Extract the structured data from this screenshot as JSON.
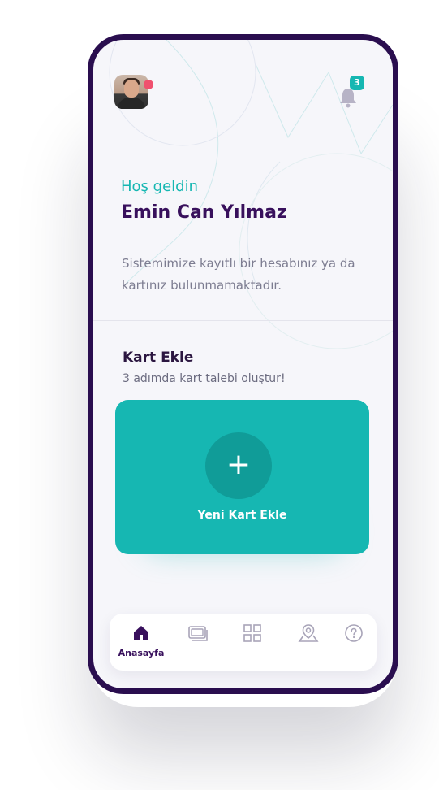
{
  "header": {
    "avatar_alt": "user-avatar",
    "notification_count": "3",
    "colors": {
      "badge": "#16b7b2",
      "status_dot": "#f0506e"
    }
  },
  "welcome": {
    "greeting": "Hoş geldin",
    "name": "Emin Can Yılmaz",
    "info": "Sistemimize kayıtlı bir hesabınız ya da kartınız bulunmamaktadır."
  },
  "add_card_section": {
    "title": "Kart Ekle",
    "subtitle": "3 adımda kart talebi oluştur!",
    "button_label": "Yeni Kart Ekle",
    "plus_symbol": "+"
  },
  "tabbar": {
    "items": [
      {
        "icon": "home-icon",
        "label": "Anasayfa",
        "active": true
      },
      {
        "icon": "wallet-icon",
        "label": "",
        "active": false
      },
      {
        "icon": "grid-icon",
        "label": "",
        "active": false
      },
      {
        "icon": "map-pin-icon",
        "label": "",
        "active": false
      },
      {
        "icon": "help-icon",
        "label": "",
        "active": false
      }
    ]
  },
  "colors": {
    "primary": "#38105c",
    "accent": "#16b7b2",
    "background": "#f6f6fa"
  }
}
